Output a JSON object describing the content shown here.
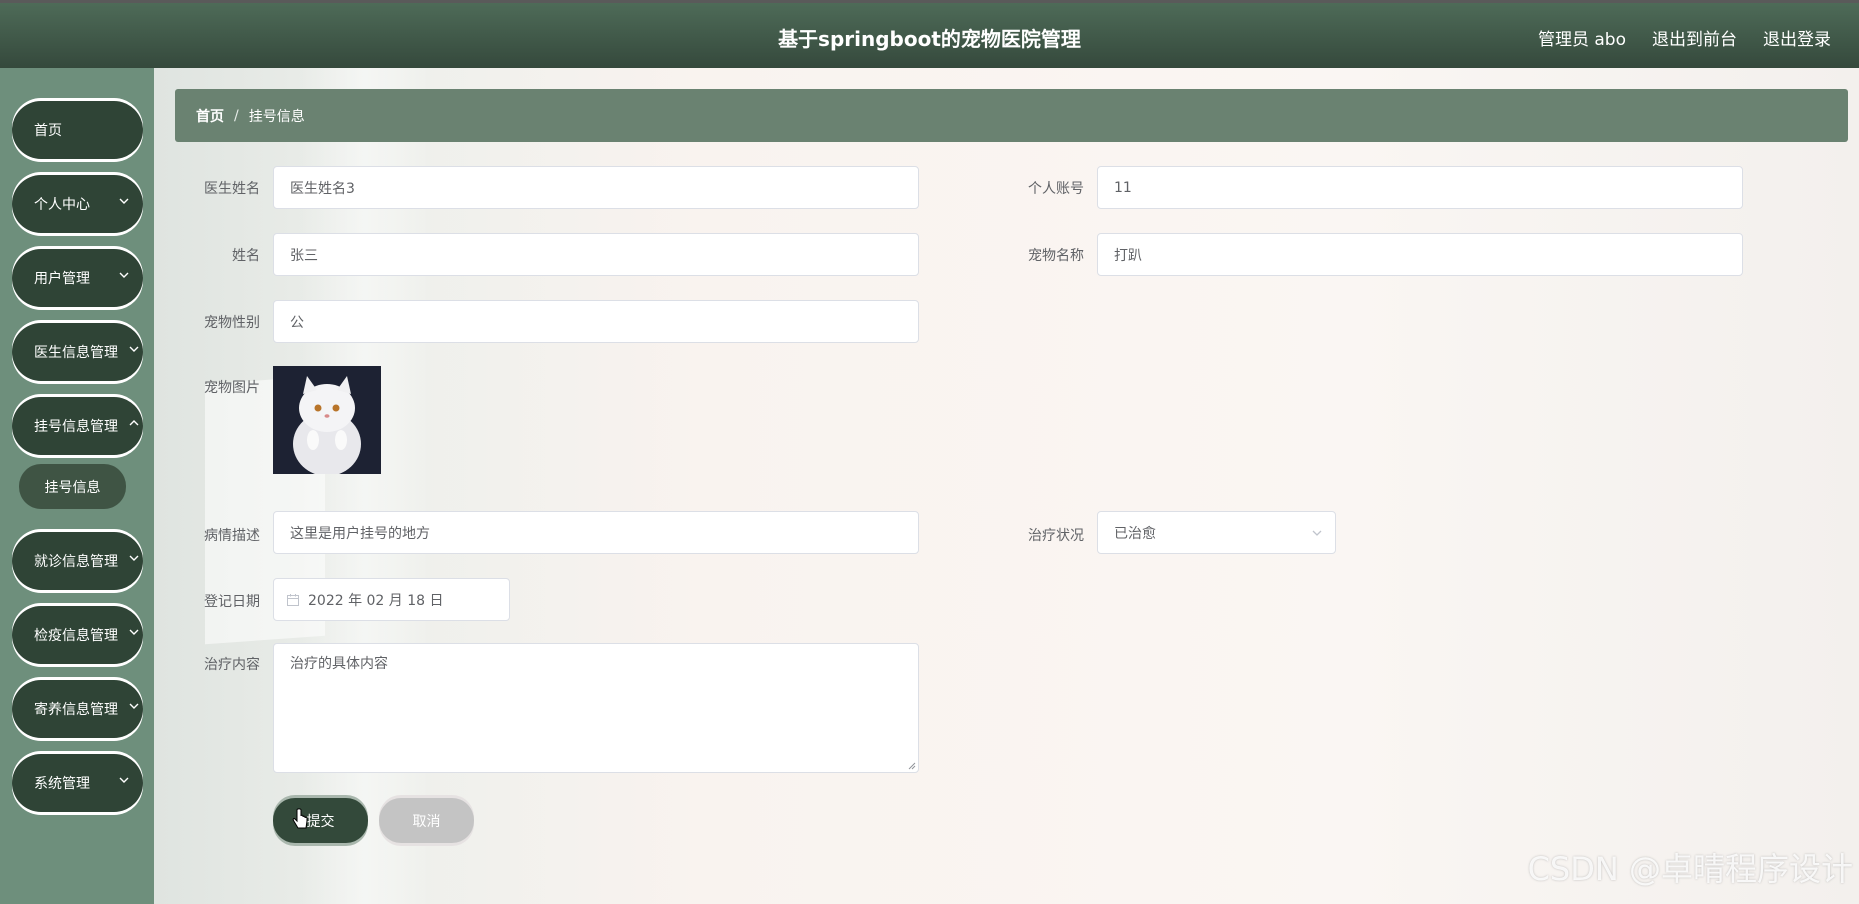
{
  "header": {
    "title": "基于springboot的宠物医院管理",
    "user_label": "管理员 abo",
    "to_frontend": "退出到前台",
    "logout": "退出登录"
  },
  "sidebar": {
    "items": [
      {
        "label": "首页"
      },
      {
        "label": "个人中心"
      },
      {
        "label": "用户管理"
      },
      {
        "label": "医生信息管理"
      },
      {
        "label": "挂号信息管理"
      },
      {
        "label": "就诊信息管理"
      },
      {
        "label": "检疫信息管理"
      },
      {
        "label": "寄养信息管理"
      },
      {
        "label": "系统管理"
      }
    ],
    "sub_item": "挂号信息"
  },
  "breadcrumb": {
    "home": "首页",
    "separator": "/",
    "current": "挂号信息"
  },
  "form": {
    "doctor_name": {
      "label": "医生姓名",
      "value": "医生姓名3"
    },
    "account": {
      "label": "个人账号",
      "value": "11"
    },
    "name": {
      "label": "姓名",
      "value": "张三"
    },
    "pet_name": {
      "label": "宠物名称",
      "value": "打趴"
    },
    "pet_gender": {
      "label": "宠物性别",
      "value": "公"
    },
    "pet_image": {
      "label": "宠物图片"
    },
    "description": {
      "label": "病情描述",
      "value": "这里是用户挂号的地方"
    },
    "treatment_status": {
      "label": "治疗状况",
      "value": "已治愈"
    },
    "register_date": {
      "label": "登记日期",
      "value": "2022 年 02 月 18 日"
    },
    "treatment_content": {
      "label": "治疗内容",
      "value": "治疗的具体内容"
    }
  },
  "buttons": {
    "submit": "提交",
    "cancel": "取消"
  },
  "watermark": "CSDN @卓晴程序设计",
  "colors": {
    "header": "#3f5646",
    "sidebar": "#6e8f7c",
    "menu_item": "#2f4436",
    "breadcrumb": "#6a8271"
  }
}
